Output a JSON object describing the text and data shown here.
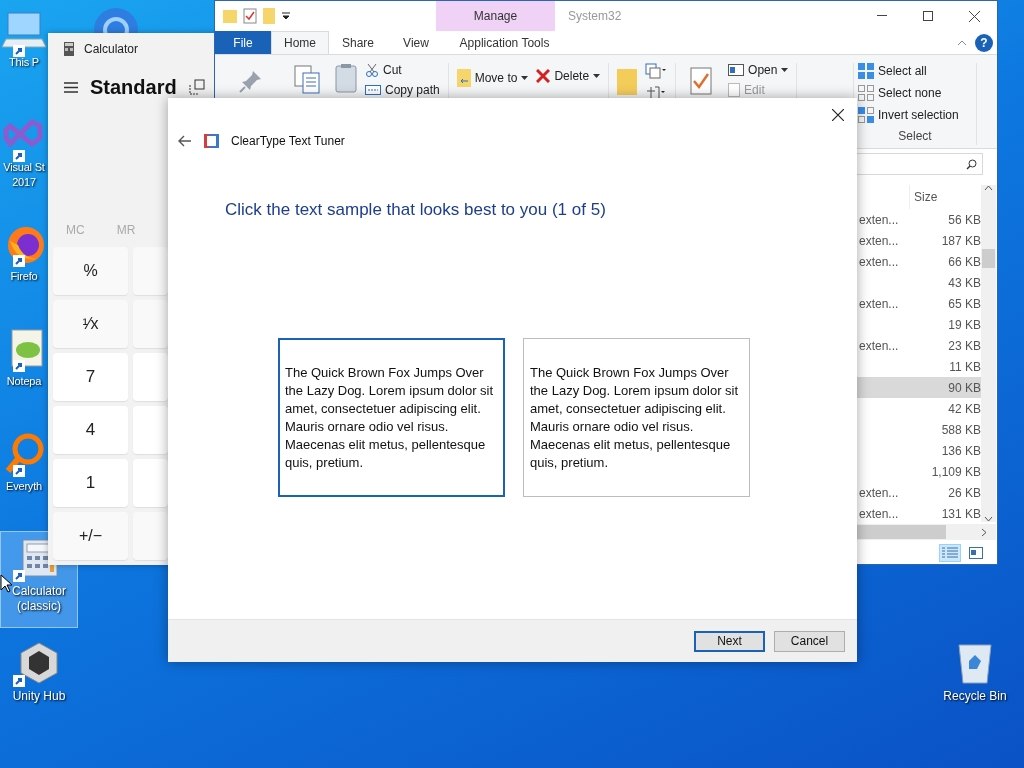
{
  "desktop_icons": [
    {
      "kind": "pc",
      "lines": [
        "This P"
      ],
      "selected": false
    },
    {
      "kind": "vs",
      "lines": [
        "Visual St",
        "2017"
      ],
      "selected": false
    },
    {
      "kind": "firefox",
      "lines": [
        "Firefo"
      ],
      "selected": false
    },
    {
      "kind": "notepad",
      "lines": [
        "Notepa"
      ],
      "selected": false
    },
    {
      "kind": "everything",
      "lines": [
        "Everyth"
      ],
      "selected": false
    },
    {
      "kind": "calc",
      "lines": [
        "Calculator",
        "(classic)"
      ],
      "selected": true
    },
    {
      "kind": "unity",
      "lines": [
        "Unity Hub"
      ],
      "selected": false
    }
  ],
  "recycle_bin": {
    "kind": "recycle",
    "lines": [
      "Recycle Bin"
    ]
  },
  "calculator": {
    "title": "Calculator",
    "mode": "Standard",
    "memory": [
      "MC",
      "MR"
    ],
    "keys": [
      {
        "label": "%",
        "kind": "op"
      },
      {
        "label": "¹⁄x",
        "kind": "op"
      },
      {
        "label": "7",
        "kind": "digit"
      },
      {
        "label": "4",
        "kind": "digit"
      },
      {
        "label": "1",
        "kind": "digit"
      },
      {
        "label": "+/−",
        "kind": "op"
      }
    ]
  },
  "explorer": {
    "context_tab": "Manage",
    "title": "System32",
    "tabs": [
      {
        "label": "File",
        "kind": "file",
        "selected": false
      },
      {
        "label": "Home",
        "kind": "tab",
        "selected": true
      },
      {
        "label": "Share",
        "kind": "tab",
        "selected": false
      },
      {
        "label": "View",
        "kind": "tab",
        "selected": false
      },
      {
        "label": "Application Tools",
        "kind": "context",
        "selected": false
      }
    ],
    "ribbon": {
      "cut": "Cut",
      "copy_path": "Copy path",
      "move_to": "Move to",
      "delete": "Delete",
      "open": "Open",
      "edit": {
        "label": "Edit",
        "disabled": true
      },
      "select_all": "Select all",
      "select_none": "Select none",
      "invert_selection": "Invert selection",
      "select_group": "Select"
    },
    "help_button": "?",
    "size_header": "Size",
    "rows": [
      {
        "column_1": "exten...",
        "size": "56 KB",
        "selected": false
      },
      {
        "column_1": "exten...",
        "size": "187 KB",
        "selected": false
      },
      {
        "column_1": "exten...",
        "size": "66 KB",
        "selected": false
      },
      {
        "size": "43 KB",
        "selected": false
      },
      {
        "column_1": "exten...",
        "size": "65 KB",
        "selected": false
      },
      {
        "size": "19 KB",
        "selected": false
      },
      {
        "column_1": "exten...",
        "size": "23 KB",
        "selected": false
      },
      {
        "size": "11 KB",
        "selected": false
      },
      {
        "size": "90 KB",
        "selected": true
      },
      {
        "size": "42 KB",
        "selected": false
      },
      {
        "size": "588 KB",
        "selected": false
      },
      {
        "size": "136 KB",
        "selected": false
      },
      {
        "size": "1,109 KB",
        "selected": false
      },
      {
        "column_1": "exten...",
        "size": "26 KB",
        "selected": false
      },
      {
        "column_1": "exten...",
        "size": "131 KB",
        "selected": false
      }
    ],
    "views": [
      {
        "kind": "details",
        "selected": true
      },
      {
        "kind": "tiles",
        "selected": false
      }
    ]
  },
  "dialog": {
    "title": "ClearType Text Tuner",
    "heading": "Click the text sample that looks best to you (1 of 5)",
    "samples": [
      {
        "text": "The Quick Brown Fox Jumps Over the Lazy Dog. Lorem ipsum dolor sit amet, consectetuer adipiscing elit. Mauris ornare odio vel risus. Maecenas elit metus, pellentesque quis, pretium.",
        "selected": true
      },
      {
        "text": "The Quick Brown Fox Jumps Over the Lazy Dog. Lorem ipsum dolor sit amet, consectetuer adipiscing elit. Mauris ornare odio vel risus. Maecenas elit metus, pellentesque quis, pretium.",
        "selected": false
      }
    ],
    "buttons": [
      {
        "label": "Next",
        "kind": "default"
      },
      {
        "label": "Cancel",
        "kind": "normal"
      }
    ]
  }
}
